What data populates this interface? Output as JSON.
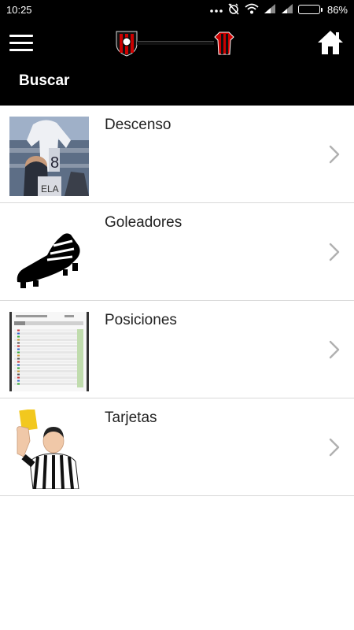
{
  "status_bar": {
    "time": "10:25",
    "battery_percent_label": "86%",
    "battery_level": 0.86,
    "icons": [
      "more-dots-icon",
      "alarm-off-icon",
      "wifi-icon",
      "signal-icon",
      "signal-icon",
      "battery-icon"
    ]
  },
  "toolbar": {
    "title": "Buscar",
    "menu_icon": "hamburger-menu-icon",
    "home_icon": "home-icon",
    "logo": "club-crest-logo"
  },
  "list": {
    "items": [
      {
        "label": "Descenso",
        "thumbnail": "descenso-photo"
      },
      {
        "label": "Goleadores",
        "thumbnail": "football-boot-icon"
      },
      {
        "label": "Posiciones",
        "thumbnail": "standings-table-image"
      },
      {
        "label": "Tarjetas",
        "thumbnail": "referee-yellow-card-image"
      }
    ]
  },
  "colors": {
    "toolbar_bg": "#000000",
    "brand_red": "#cc0000",
    "divider": "#d8d8d8",
    "chevron": "#b0b0b0",
    "text": "#222222"
  }
}
